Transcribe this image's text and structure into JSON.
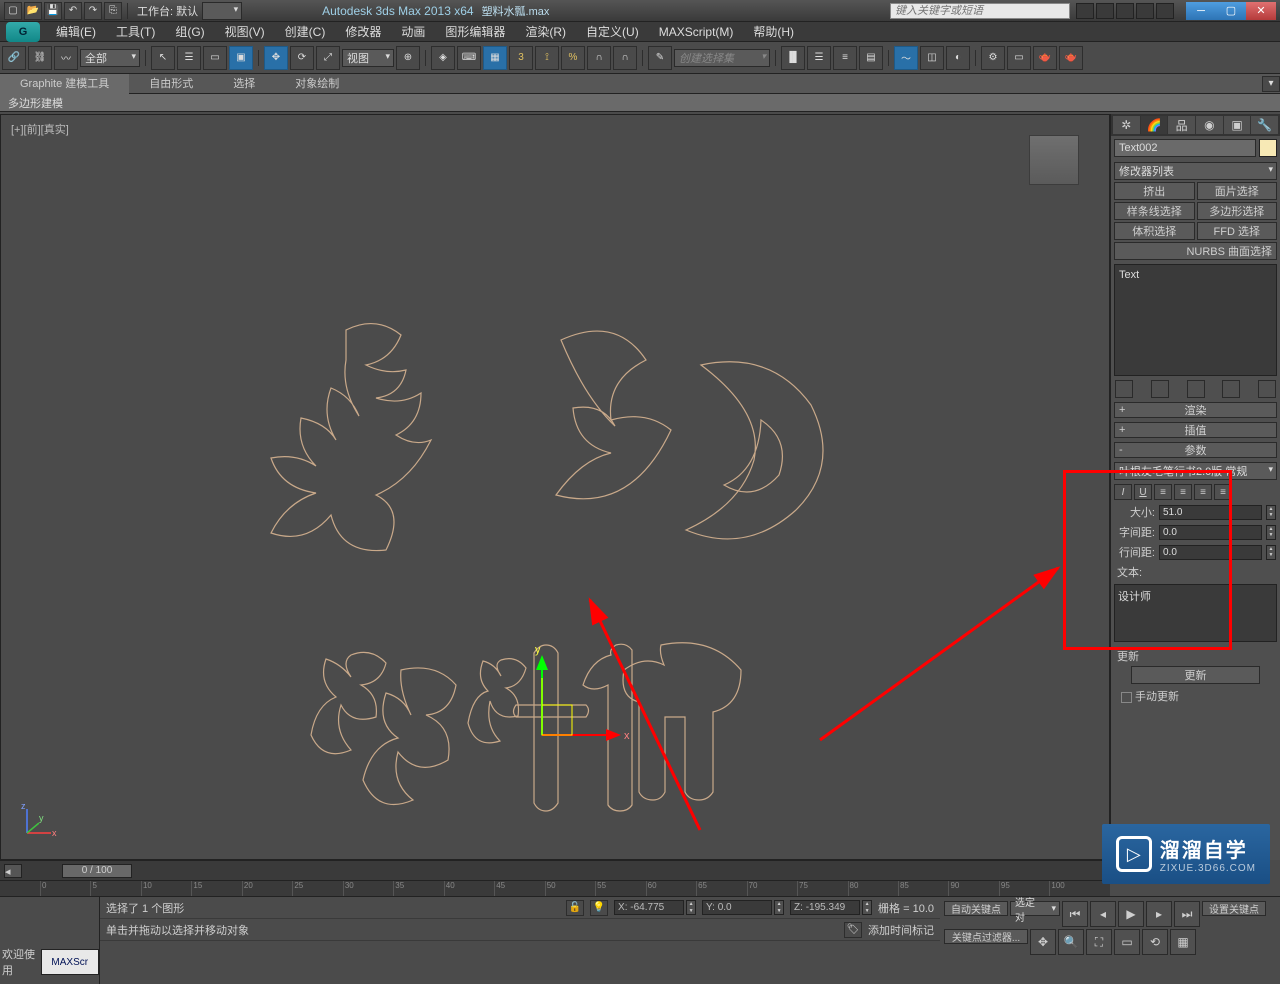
{
  "titlebar": {
    "workspace_label": "工作台: 默认",
    "app_title": "Autodesk 3ds Max  2013 x64",
    "file_name": "塑料水瓢.max",
    "search_placeholder": "键入关键字或短语"
  },
  "menus": [
    "编辑(E)",
    "工具(T)",
    "组(G)",
    "视图(V)",
    "创建(C)",
    "修改器",
    "动画",
    "图形编辑器",
    "渲染(R)",
    "自定义(U)",
    "MAXScript(M)",
    "帮助(H)"
  ],
  "toolbar": {
    "filter": "全部",
    "coordsys": "视图",
    "selset_placeholder": "创建选择集"
  },
  "ribbon": {
    "tabs": [
      "Graphite 建模工具",
      "自由形式",
      "选择",
      "对象绘制"
    ],
    "sub": "多边形建模"
  },
  "viewport": {
    "label": "[+][前][真实]"
  },
  "cmdpanel": {
    "obj_name": "Text002",
    "mod_list": "修改器列表",
    "mod_buttons": [
      [
        "挤出",
        "面片选择"
      ],
      [
        "样条线选择",
        "多边形选择"
      ],
      [
        "体积选择",
        "FFD 选择"
      ]
    ],
    "nurbs_label": "NURBS 曲面选择",
    "stack_item": "Text",
    "rollups": {
      "render": "渲染",
      "interp": "插值",
      "params": "参数"
    },
    "font": "叶根友毛笔行书2.0版 常规",
    "size_label": "大小:",
    "size_val": "51.0",
    "kern_label": "字间距:",
    "kern_val": "0.0",
    "lead_label": "行间距:",
    "lead_val": "0.0",
    "text_label": "文本:",
    "text_value": "设计师",
    "update_section": "更新",
    "update_btn": "更新",
    "manual_update": "手动更新"
  },
  "timeslider": {
    "knob": "0 / 100"
  },
  "status": {
    "welcome": "欢迎使用",
    "maxscr": "MAXScr",
    "sel_msg": "选择了 1 个图形",
    "prompt": "单击并拖动以选择并移动对象",
    "x": "X: -64.775",
    "y": "Y: 0.0",
    "z": "Z: -195.349",
    "grid": "栅格 = 10.0",
    "addtime": "添加时间标记",
    "autokey": "自动关键点",
    "setkey": "设置关键点",
    "keyfilter": "关键点过滤器...",
    "seldrop": "选定对"
  },
  "watermark": {
    "cn": "溜溜自学",
    "en": "ZIXUE.3D66.COM"
  }
}
